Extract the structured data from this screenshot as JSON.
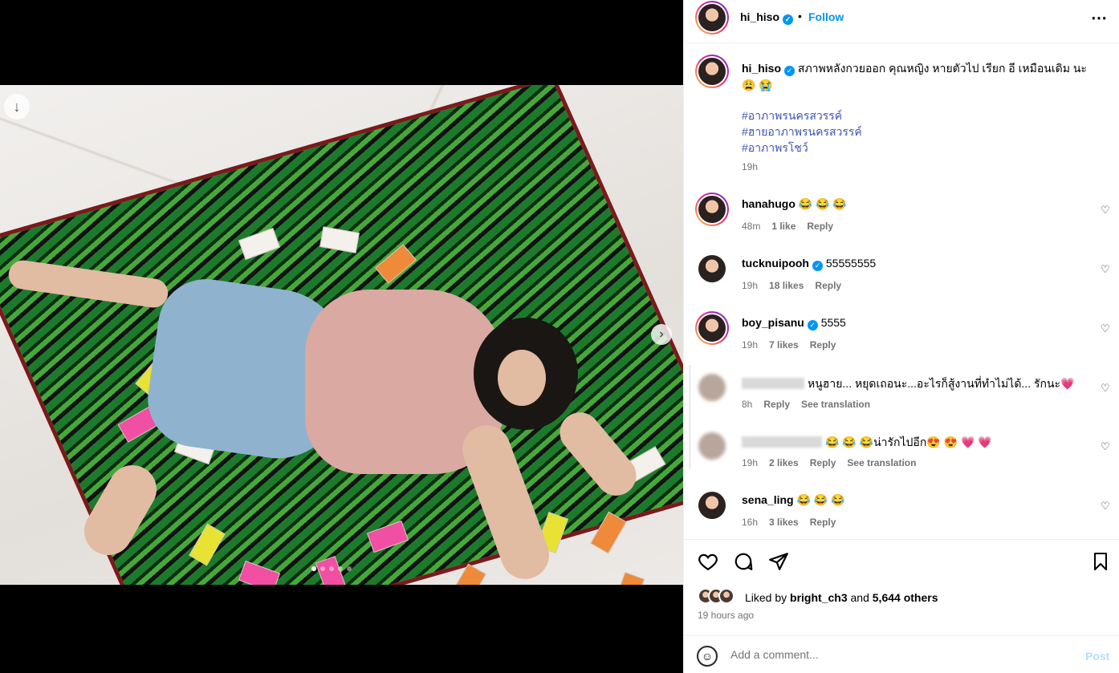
{
  "header": {
    "username": "hi_hiso",
    "separator": "•",
    "follow_label": "Follow",
    "more_icon": "⋯"
  },
  "caption": {
    "username": "hi_hiso",
    "text": "สภาพหลังกวยออก คุณหญิง หายตัวไป เรียก อี เหมือนเดิม นะ 😩 😭",
    "hashtags": [
      "#อาภาพรนครสวรรค์",
      "#ฮายอาภาพรนครสวรรค์",
      "#อาภาพรโชว์"
    ],
    "time": "19h"
  },
  "comments": [
    {
      "username": "hanahugo",
      "text": "😂 😂 😂",
      "time": "48m",
      "likes": "1 like",
      "reply": "Reply",
      "translation": ""
    },
    {
      "username": "tucknuipooh",
      "text": "55555555",
      "time": "19h",
      "likes": "18 likes",
      "reply": "Reply",
      "translation": ""
    },
    {
      "username": "boy_pisanu",
      "text": "5555",
      "time": "19h",
      "likes": "7 likes",
      "reply": "Reply",
      "translation": ""
    },
    {
      "username": "",
      "text": "หนูฮาย... หยุดเถอนะ...อะไรก็สู้งานที่ทำไม่ได้... รักนะ💗",
      "time": "8h",
      "likes": "",
      "reply": "Reply",
      "translation": "See translation"
    },
    {
      "username": "",
      "text": "😂 😂 😂น่ารักไปอีก😍 😍 💗 💗",
      "time": "19h",
      "likes": "2 likes",
      "reply": "Reply",
      "translation": "See translation"
    },
    {
      "username": "sena_ling",
      "text": "😂 😂 😂",
      "time": "16h",
      "likes": "3 likes",
      "reply": "Reply",
      "translation": ""
    }
  ],
  "likes": {
    "prefix": "Liked by",
    "user": "bright_ch3",
    "and": "and",
    "others": "5,644 others",
    "time_ago": "19 hours ago"
  },
  "add_comment": {
    "placeholder": "Add a comment...",
    "post_label": "Post",
    "emoji": "☺"
  },
  "carousel": {
    "slide_count": 5,
    "current": 1
  },
  "colors": {
    "accent": "#0095f6",
    "hashtag": "#4154b8",
    "muted": "#737373"
  }
}
